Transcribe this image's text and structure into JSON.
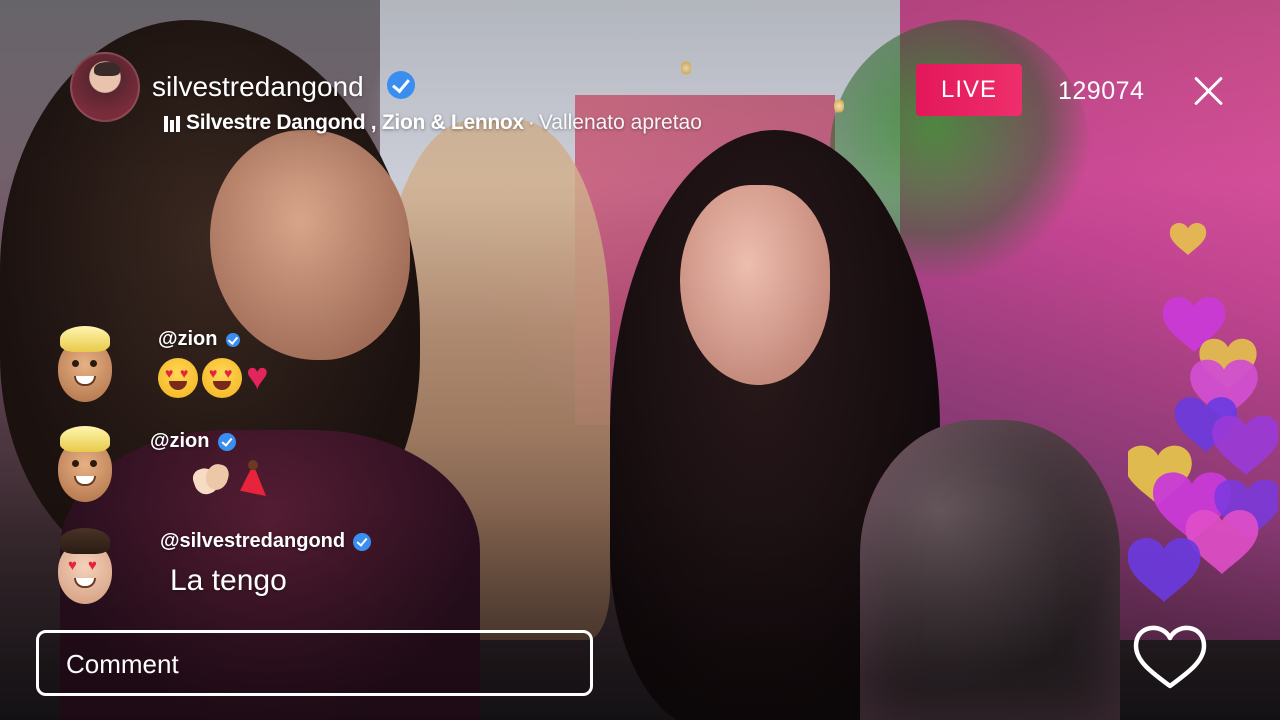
{
  "header": {
    "username": "silvestredangond",
    "song": {
      "artist": "Silvestre Dangond , Zion & Lennox",
      "separator": "·",
      "title": "Vallenato apretao"
    },
    "live_label": "LIVE",
    "viewer_count": "129074"
  },
  "comments": [
    {
      "user": "@zion",
      "text": ""
    },
    {
      "user": "@zion",
      "text": ""
    },
    {
      "user": "@silvestredangond",
      "text": "La tengo"
    }
  ],
  "comment_input": {
    "placeholder": "Comment",
    "value": ""
  },
  "colors": {
    "live_badge": "#e3175a",
    "verified": "#3a8ef0",
    "hearts": [
      "#c93ad6",
      "#7a3ae0",
      "#e8c94a",
      "#e04fc8"
    ]
  },
  "icons": [
    "verified-badge-icon",
    "equalizer-icon",
    "close-icon",
    "heart-outline-icon"
  ]
}
